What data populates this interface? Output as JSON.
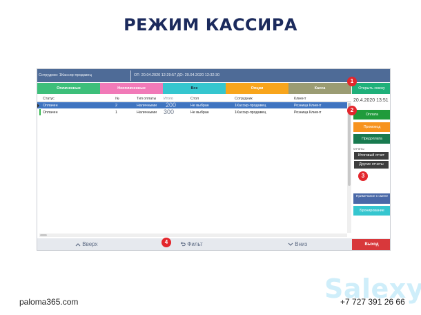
{
  "slide_title": "РЕЖИМ КАССИРА",
  "topbar": {
    "seller": "Сотрудник: 1Кассир-продавец",
    "period": "ОТ: 20.04.2020 12:29:57 ДО: 20.04.2020 12:32:30"
  },
  "filters": [
    "Оплаченные",
    "Неоплаченные",
    "Все",
    "Опции",
    "Касса"
  ],
  "open_shift": "Открыть смену",
  "table": {
    "headers": [
      "Статус",
      "№",
      "Тип оплаты",
      "Итого",
      "Стол",
      "Сотрудник",
      "Клиент"
    ],
    "rows": [
      [
        "Оплачен",
        "2",
        "Наличными",
        "200",
        "Не выбран",
        "1Кассир-продавец",
        "Розница Клиент"
      ],
      [
        "Оплачен",
        "1",
        "Наличными",
        "300",
        "Не выбран",
        "1Кассир-продавец",
        "Розница Клиент"
      ]
    ]
  },
  "side": {
    "datetime": "20.4.2020 13:51",
    "pay": "Оплата",
    "promo": "Промокод",
    "prepay": "Предоплата",
    "reports_label": "Отчеты",
    "final_report": "Итоговый отчет",
    "other_reports": "Другие отчеты",
    "shift_note": "Примечание к смене",
    "booking": "Бронирование"
  },
  "bottom": {
    "up": "Вверх",
    "filter": "Фильт",
    "down": "Вниз",
    "exit": "Выход"
  },
  "badges": [
    "1",
    "2",
    "3",
    "4"
  ],
  "footer": {
    "site": "paloma365.com",
    "phone": "+7 727 391 26 66",
    "logo": "Salexy"
  },
  "icons": {
    "up": "chevron-up-icon",
    "filter": "undo-arrow-icon",
    "down": "chevron-down-icon",
    "row_pointer": "triangle-right-icon"
  },
  "colors": {
    "paid": "#3dbf7a",
    "unpaid": "#f17ab8",
    "all": "#35c6cf",
    "options": "#f8a51c",
    "cash": "#9b9c73",
    "pay": "#1f9b3b",
    "exit": "#d8383b"
  }
}
